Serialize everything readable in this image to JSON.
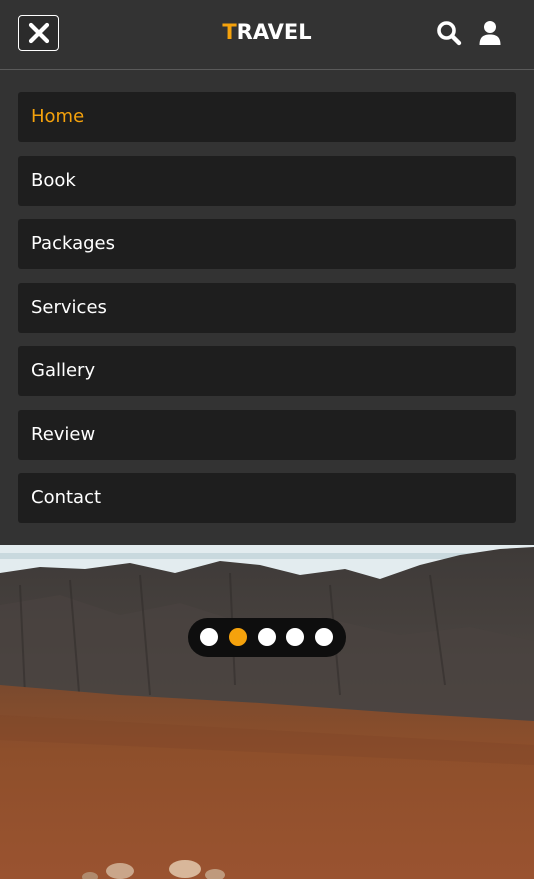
{
  "header": {
    "logo_first": "T",
    "logo_rest": "RAVEL",
    "accent_color": "#f5a20c",
    "close_icon": "close-icon",
    "search_icon": "search-icon",
    "user_icon": "user-icon"
  },
  "menu": {
    "items": [
      {
        "label": "Home",
        "active": true
      },
      {
        "label": "Book",
        "active": false
      },
      {
        "label": "Packages",
        "active": false
      },
      {
        "label": "Services",
        "active": false
      },
      {
        "label": "Gallery",
        "active": false
      },
      {
        "label": "Review",
        "active": false
      },
      {
        "label": "Contact",
        "active": false
      }
    ]
  },
  "slider": {
    "dot_count": 5,
    "active_index": 1
  }
}
